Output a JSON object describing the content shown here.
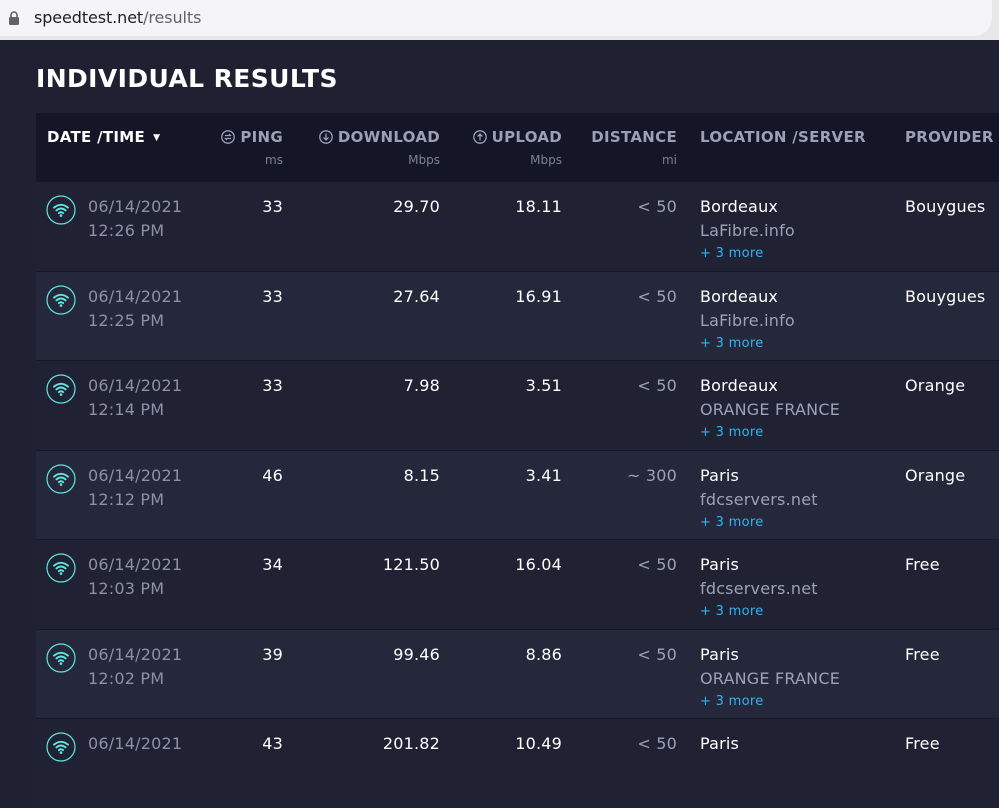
{
  "browser": {
    "url_host": "speedtest.net",
    "url_path": "/results"
  },
  "page": {
    "title": "INDIVIDUAL RESULTS"
  },
  "table": {
    "headers": {
      "date": "DATE /TIME",
      "ping": "PING",
      "ping_unit": "ms",
      "download": "DOWNLOAD",
      "download_unit": "Mbps",
      "upload": "UPLOAD",
      "upload_unit": "Mbps",
      "distance": "DISTANCE",
      "distance_unit": "mi",
      "location": "LOCATION /SERVER",
      "provider": "PROVIDER"
    },
    "rows": [
      {
        "date": "06/14/2021",
        "time": "12:26 PM",
        "ping": "33",
        "download": "29.70",
        "upload": "18.11",
        "distance": "< 50",
        "location": "Bordeaux",
        "server": "LaFibre.info",
        "more": "+ 3 more",
        "provider": "Bouygues"
      },
      {
        "date": "06/14/2021",
        "time": "12:25 PM",
        "ping": "33",
        "download": "27.64",
        "upload": "16.91",
        "distance": "< 50",
        "location": "Bordeaux",
        "server": "LaFibre.info",
        "more": "+ 3 more",
        "provider": "Bouygues"
      },
      {
        "date": "06/14/2021",
        "time": "12:14 PM",
        "ping": "33",
        "download": "7.98",
        "upload": "3.51",
        "distance": "< 50",
        "location": "Bordeaux",
        "server": "ORANGE FRANCE",
        "more": "+ 3 more",
        "provider": "Orange"
      },
      {
        "date": "06/14/2021",
        "time": "12:12 PM",
        "ping": "46",
        "download": "8.15",
        "upload": "3.41",
        "distance": "~ 300",
        "location": "Paris",
        "server": "fdcservers.net",
        "more": "+ 3 more",
        "provider": "Orange"
      },
      {
        "date": "06/14/2021",
        "time": "12:03 PM",
        "ping": "34",
        "download": "121.50",
        "upload": "16.04",
        "distance": "< 50",
        "location": "Paris",
        "server": "fdcservers.net",
        "more": "+ 3 more",
        "provider": "Free"
      },
      {
        "date": "06/14/2021",
        "time": "12:02 PM",
        "ping": "39",
        "download": "99.46",
        "upload": "8.86",
        "distance": "< 50",
        "location": "Paris",
        "server": "ORANGE FRANCE",
        "more": "+ 3 more",
        "provider": "Free"
      },
      {
        "date": "06/14/2021",
        "time": "",
        "ping": "43",
        "download": "201.82",
        "upload": "10.49",
        "distance": "< 50",
        "location": "Paris",
        "server": "",
        "more": "",
        "provider": "Free"
      }
    ]
  },
  "icons": {
    "connection": "wifi-icon",
    "ping": "ping-icon",
    "download": "download-icon",
    "upload": "upload-icon",
    "sort": "sort-arrow-icon",
    "lock": "lock-icon"
  },
  "colors": {
    "accent_blue": "#2eb3f1",
    "wifi_teal": "#5ee6e0",
    "background": "#1f2133",
    "header_bg": "#141627"
  }
}
